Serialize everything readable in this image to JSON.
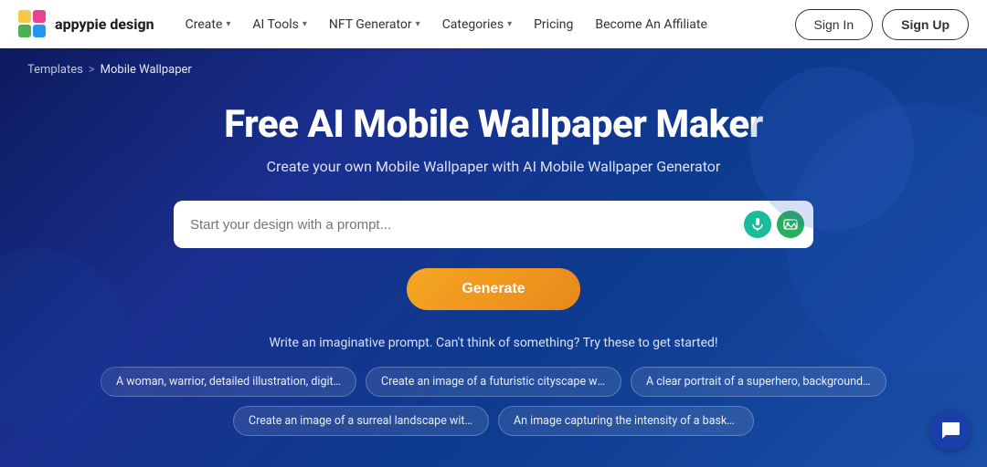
{
  "nav": {
    "logo_text": "appypie design",
    "items": [
      {
        "label": "Create",
        "has_dropdown": true
      },
      {
        "label": "AI Tools",
        "has_dropdown": true
      },
      {
        "label": "NFT Generator",
        "has_dropdown": true
      },
      {
        "label": "Categories",
        "has_dropdown": true
      },
      {
        "label": "Pricing",
        "has_dropdown": false
      },
      {
        "label": "Become An Affiliate",
        "has_dropdown": false
      }
    ],
    "signin_label": "Sign In",
    "signup_label": "Sign Up"
  },
  "breadcrumb": {
    "parent": "Templates",
    "separator": ">",
    "current": "Mobile Wallpaper"
  },
  "hero": {
    "title": "Free AI Mobile Wallpaper Maker",
    "subtitle": "Create your own Mobile Wallpaper with AI Mobile Wallpaper Generator",
    "search_placeholder": "Start your design with a prompt...",
    "generate_label": "Generate",
    "prompt_hint": "Write an imaginative prompt. Can't think of something? Try these to get started!",
    "pills_row1": [
      "A woman, warrior, detailed illustration, digital art,...",
      "Create an image of a futuristic cityscape with to...",
      "A clear portrait of a superhero, background hype..."
    ],
    "pills_row2": [
      "Create an image of a surreal landscape with flo...",
      "An image capturing the intensity of a basketball ..."
    ]
  }
}
